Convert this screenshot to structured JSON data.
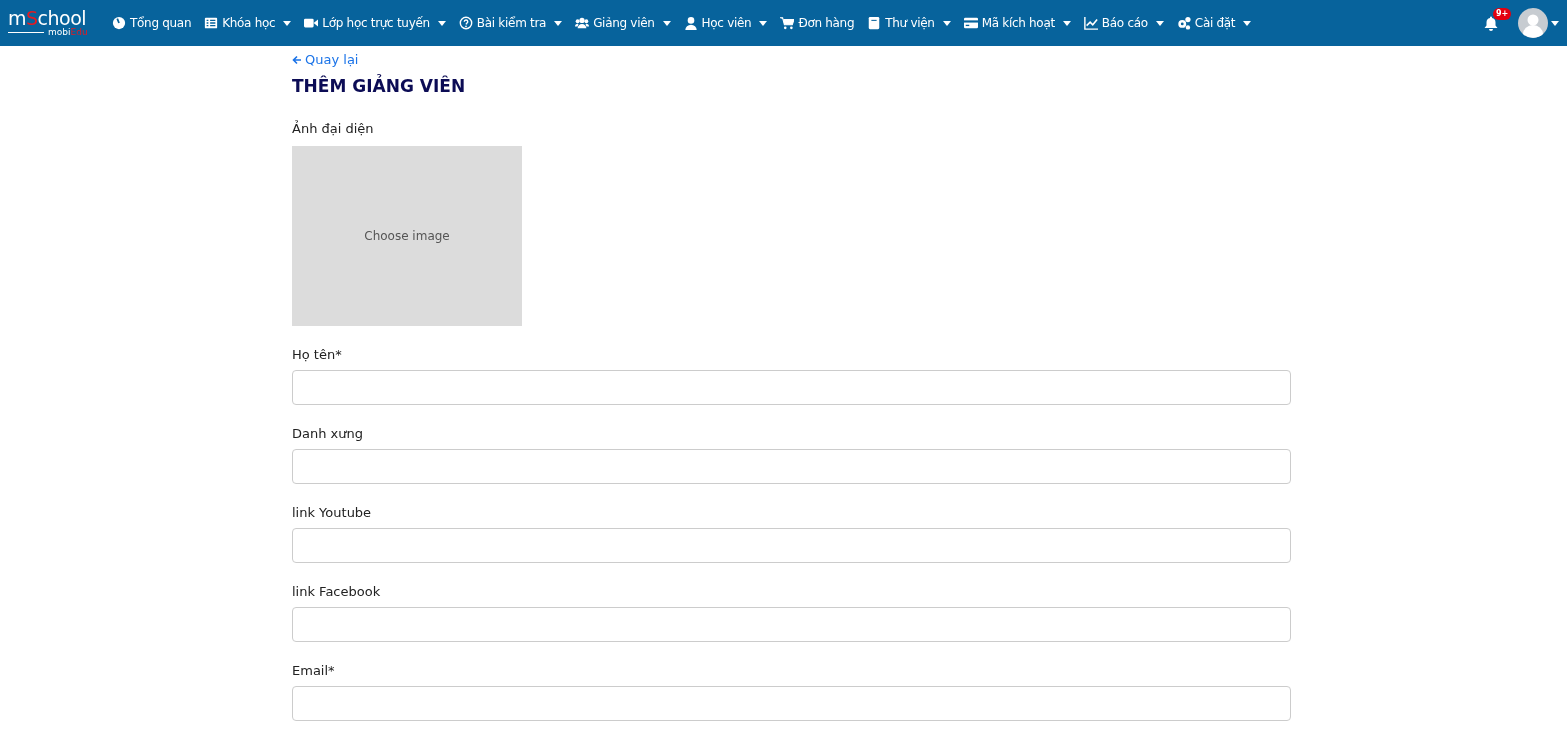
{
  "logo": {
    "main": [
      "m",
      "S",
      "chool"
    ],
    "sub": [
      "mobi",
      "Edu"
    ]
  },
  "nav": [
    {
      "label": "Tổng quan",
      "dropdown": false
    },
    {
      "label": "Khóa học",
      "dropdown": true
    },
    {
      "label": "Lớp học trực tuyến",
      "dropdown": true
    },
    {
      "label": "Bài kiểm tra",
      "dropdown": true
    },
    {
      "label": "Giảng viên",
      "dropdown": true
    },
    {
      "label": "Học viên",
      "dropdown": true
    },
    {
      "label": "Đơn hàng",
      "dropdown": false
    },
    {
      "label": "Thư viện",
      "dropdown": true
    },
    {
      "label": "Mã kích hoạt",
      "dropdown": true
    },
    {
      "label": "Báo cáo",
      "dropdown": true
    },
    {
      "label": "Cài đặt",
      "dropdown": true
    }
  ],
  "notifications": {
    "badge": "9+"
  },
  "back_link": "Quay lại",
  "page_title": "THÊM GIẢNG VIÊN",
  "avatar_field": {
    "label": "Ảnh đại diện",
    "button": "Choose image"
  },
  "fields": [
    {
      "label": "Họ tên*"
    },
    {
      "label": "Danh xưng"
    },
    {
      "label": "link Youtube"
    },
    {
      "label": "link Facebook"
    },
    {
      "label": "Email*"
    }
  ]
}
